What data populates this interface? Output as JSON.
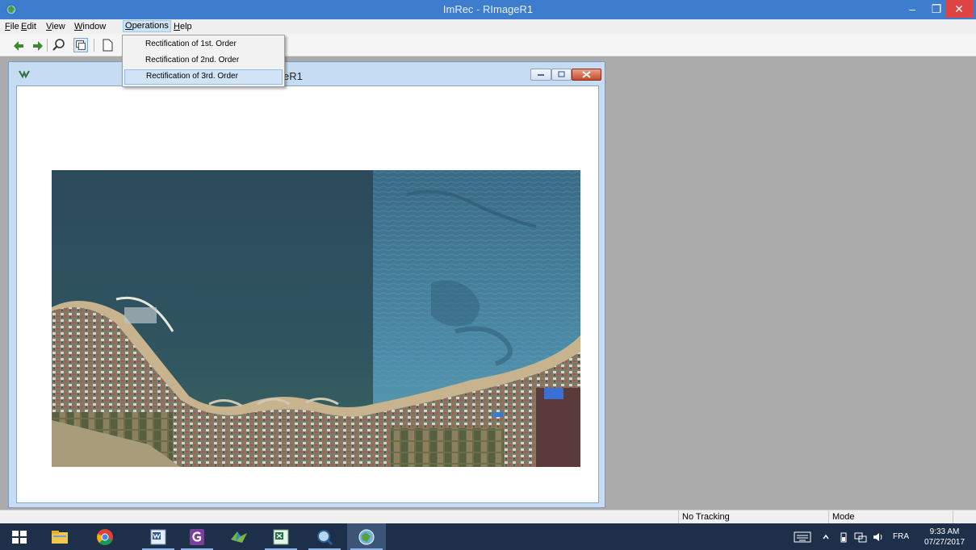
{
  "window": {
    "title": "ImRec - RImageR1",
    "minimize_glyph": "–",
    "maximize_glyph": "❐",
    "close_glyph": "✕"
  },
  "menu": {
    "items": [
      {
        "label_u": "F",
        "label_rest": "ile"
      },
      {
        "label_u": "E",
        "label_rest": "dit"
      },
      {
        "label_u": "V",
        "label_rest": "iew"
      },
      {
        "label_u": "W",
        "label_rest": "indow"
      },
      {
        "label_u": "O",
        "label_rest": "perations"
      },
      {
        "label_u": "H",
        "label_rest": "elp"
      }
    ],
    "active_index": 4
  },
  "operations_menu": {
    "items": [
      {
        "label": "Rectification of 1st. Order"
      },
      {
        "label": "Rectification of 2nd. Order"
      },
      {
        "label": "Rectification of 3rd. Order",
        "highlighted": true
      }
    ]
  },
  "child_window": {
    "title_visible": "eR1"
  },
  "status_bar": {
    "tracking": "No Tracking",
    "mode": "Mode"
  },
  "taskbar": {
    "apps": [
      {
        "icon": "windows-start-icon"
      },
      {
        "icon": "file-explorer-icon"
      },
      {
        "icon": "chrome-icon"
      },
      {
        "icon": "word-icon"
      },
      {
        "icon": "pdf-creator-icon"
      },
      {
        "icon": "gis-icon"
      },
      {
        "icon": "excel-icon"
      },
      {
        "icon": "search-app-icon"
      },
      {
        "icon": "imrec-icon"
      }
    ],
    "language": "FRA",
    "time": "9:33 AM",
    "date": "07/27/2017"
  },
  "colors": {
    "titlebar": "#3e7ccd",
    "close_button": "#e04343",
    "mdi_background": "#ababab",
    "taskbar": "#1d2f49",
    "menu_highlight": "#d1e3f6"
  }
}
